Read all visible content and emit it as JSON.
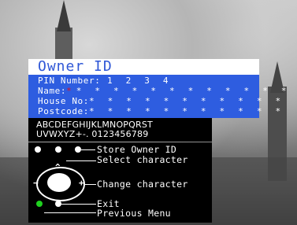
{
  "screen": {
    "title": "Owner ID",
    "fields": [
      {
        "label": "PIN Number:",
        "value": "1 2 3 4",
        "cursor": ""
      },
      {
        "label": "Name:",
        "value": "* * * * * * * * * * * *",
        "cursor": "*"
      },
      {
        "label": "House No:",
        "value": "* * * * * * * * * * *",
        "cursor": ""
      },
      {
        "label": "Postcode:",
        "value": "* * * * * * * * * * *",
        "cursor": ""
      }
    ]
  },
  "charset": {
    "line1": "ABCDEFGHIJKLMNOPQRST",
    "line2": "UVWXYZ+-.  0123456789"
  },
  "legend": {
    "store": "Store Owner ID",
    "select": "Select character",
    "change": "Change character",
    "exit": "Exit",
    "previous": "Previous Menu"
  },
  "colors": {
    "accent_blue": "#2e5de0",
    "title_blue": "#2f57d6",
    "cursor_red": "#e3101f",
    "exit_green": "#1fd11f"
  }
}
